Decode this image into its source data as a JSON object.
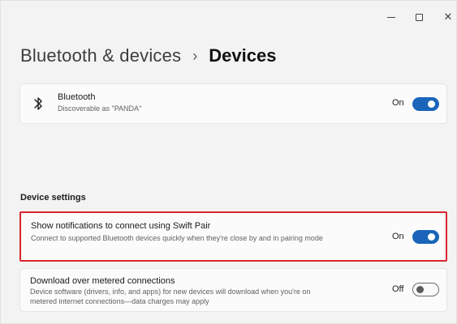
{
  "window": {
    "minimize_label": "–",
    "maximize_label": "",
    "close_label": "✕"
  },
  "breadcrumb": {
    "parent": "Bluetooth & devices",
    "separator": "›",
    "current": "Devices"
  },
  "bluetooth": {
    "icon": "bluetooth-icon",
    "title": "Bluetooth",
    "description": "Discoverable as \"PANDA\"",
    "state_label": "On",
    "enabled": true
  },
  "device_settings": {
    "heading": "Device settings",
    "swift_pair": {
      "title": "Show notifications to connect using Swift Pair",
      "description": "Connect to supported Bluetooth devices quickly when they're close by and in pairing mode",
      "state_label": "On",
      "enabled": true,
      "highlight_color": "#d9252c"
    },
    "metered": {
      "title": "Download over metered connections",
      "description": "Device software (drivers, info, and apps) for new devices will download when you're on metered internet connections—data charges may apply",
      "state_label": "Off",
      "enabled": false
    }
  },
  "colors": {
    "accent": "#1a65b9",
    "background": "#f3f3f3",
    "card": "#fbfbfb"
  }
}
